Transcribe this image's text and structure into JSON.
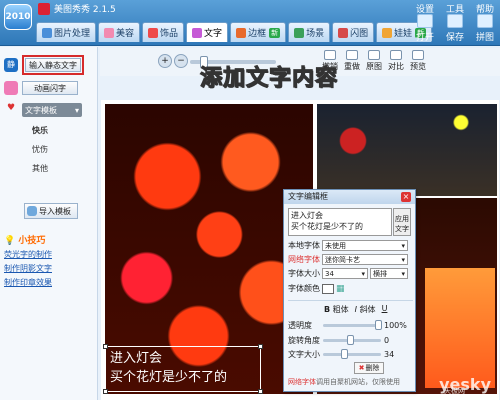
{
  "app": {
    "title": "美图秀秀 2.1.5",
    "logo": "2010"
  },
  "top_menu": [
    "设置",
    "工具",
    "帮助"
  ],
  "tabs": [
    {
      "label": "图片处理",
      "icon": "image-icon",
      "active": false
    },
    {
      "label": "美容",
      "icon": "face-icon",
      "active": false
    },
    {
      "label": "饰品",
      "icon": "heart-icon",
      "active": false
    },
    {
      "label": "文字",
      "icon": "text-icon",
      "active": true
    },
    {
      "label": "边框",
      "icon": "frame-icon",
      "active": false,
      "badge": "新"
    },
    {
      "label": "场景",
      "icon": "scene-icon",
      "active": false
    },
    {
      "label": "闪图",
      "icon": "flash-icon",
      "active": false
    },
    {
      "label": "娃娃",
      "icon": "doll-icon",
      "active": false,
      "badge": "新"
    }
  ],
  "actions": [
    {
      "label": "打开",
      "icon": "open-icon"
    },
    {
      "label": "保存",
      "icon": "save-icon"
    },
    {
      "label": "拼图",
      "icon": "collage-icon"
    }
  ],
  "left": {
    "static_text_icon": "静",
    "static_text_button": "输入静态文字",
    "anim_text_button": "动画闪字",
    "template_dropdown": "文字模板",
    "categories": [
      "快乐",
      "忧伤",
      "其他"
    ],
    "import_button": "导入模板",
    "tips_title": "小技巧",
    "tips_links": [
      "荧光字的制作",
      "制作阴影文字",
      "制作印章效果"
    ]
  },
  "toolbar": {
    "zoom_in": "+",
    "zoom_out": "−",
    "tools": [
      "撤销",
      "重做",
      "原图",
      "对比",
      "预览"
    ]
  },
  "headline": "添加文字内容",
  "canvas_text": {
    "line1": "进入灯会",
    "line2": "买个花灯是少不了的"
  },
  "dialog": {
    "title": "文字编辑框",
    "text_value": "进入灯会\n买个花灯是少不了的",
    "apply": "应用文字",
    "local_font_label": "本地字体",
    "local_font_value": "未使用",
    "web_font_label": "网络字体",
    "web_font_value": "迷你简卡艺",
    "size_label": "字体大小",
    "size_value": "34",
    "direction_value": "横排",
    "color_label": "字体颜色",
    "bold_label": "粗体",
    "italic_label": "斜体",
    "underline_label": "U",
    "opacity_label": "透明度",
    "opacity_value": "100%",
    "rotation_label": "旋转角度",
    "rotation_value": "0",
    "size2_label": "文字大小",
    "size2_value": "34",
    "delete_button": "删除",
    "note_red": "网络字体",
    "note_rest": "调用自聚机网站，仅限使用"
  },
  "watermark": {
    "main": "yesky",
    "sub": "天极网"
  }
}
